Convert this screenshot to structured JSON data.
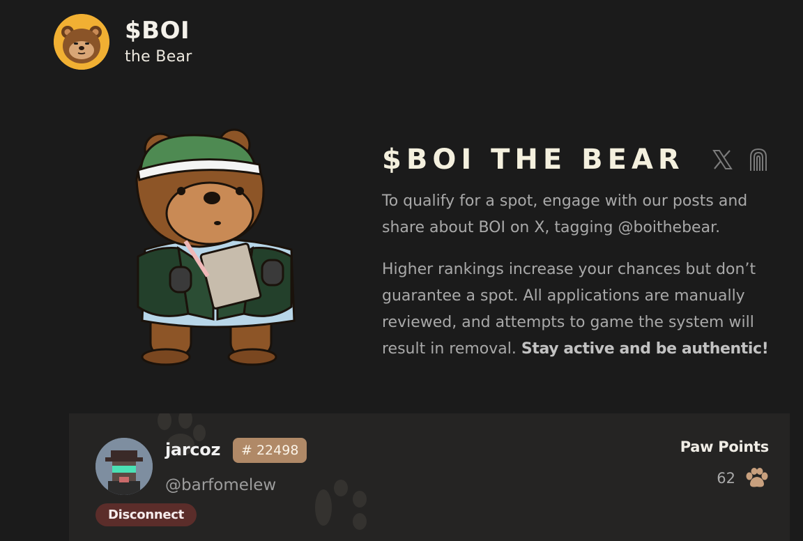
{
  "brand": {
    "title": "$BOI",
    "subtitle": "the Bear"
  },
  "hero": {
    "title": "$BOI THE BEAR",
    "paragraph1": "To qualify for a spot, engage with our posts and share about BOI on X, tagging @boithebear.",
    "paragraph2_text": "Higher rankings increase your chances but don’t guarantee a spot. All applications are manually reviewed, and attempts to game the system will result in removal.",
    "paragraph2_bold": "Stay active and be authentic!",
    "social_icons": [
      "x-icon",
      "fingerprint-icon"
    ]
  },
  "user": {
    "name": "jarcoz",
    "rank": "# 22498",
    "handle": "@barfomelew",
    "disconnect_label": "Disconnect",
    "points_label": "Paw Points",
    "points_value": "62"
  },
  "colors": {
    "background": "#1b1b1b",
    "card": "#252423",
    "badge": "#b08967",
    "disconnect": "#5b2d2a",
    "brand_avatar": "#f1b033"
  }
}
